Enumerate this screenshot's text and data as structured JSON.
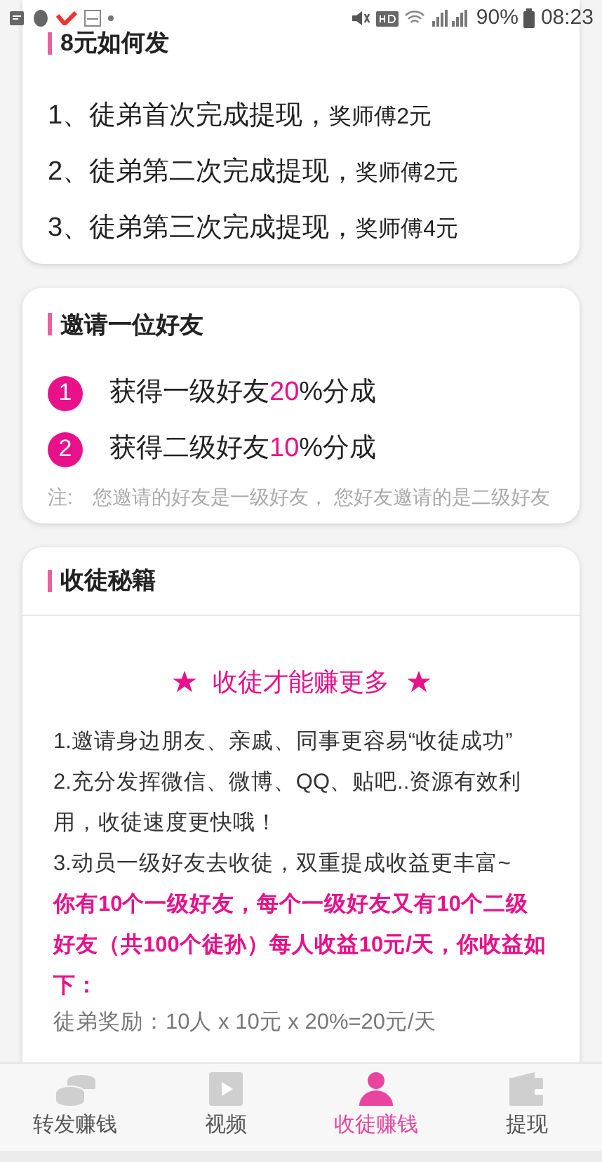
{
  "status_bar": {
    "battery": "90%",
    "time": "08:23"
  },
  "payout_card": {
    "title": "8元如何发",
    "items": [
      {
        "main": "1、徒弟首次完成提现，",
        "reward": "奖师傅2元"
      },
      {
        "main": "2、徒弟第二次完成提现，",
        "reward": "奖师傅2元"
      },
      {
        "main": "3、徒弟第三次完成提现，",
        "reward": "奖师傅4元"
      }
    ]
  },
  "invite_card": {
    "title": "邀请一位好友",
    "items": [
      {
        "number": "1",
        "before": "获得一级好友",
        "highlight": "20",
        "after": "%分成"
      },
      {
        "number": "2",
        "before": "获得二级好友",
        "highlight": "10",
        "after": "%分成"
      }
    ],
    "note_label": "注:",
    "note": "您邀请的好友是一级好友， 您好友邀请的是二级好友"
  },
  "tips_card": {
    "title": "收徒秘籍",
    "slogan": "收徒才能赚更多",
    "lines": [
      "1.邀请身边朋友、亲戚、同事更容易“收徒成功”",
      "2.充分发挥微信、微博、QQ、贴吧..资源有效利用，收徒速度更快哦！",
      "3.动员一级好友去收徒，双重提成收益更丰富~"
    ],
    "highlight": "你有10个一级好友，每个一级好友又有10个二级好友（共100个徒孙）每人收益10元/天，你收益如下：",
    "reward_line": "徒弟奖励：10人 x 10元 x 20%=20元/天"
  },
  "tab_bar": [
    {
      "label": "转发赚钱",
      "kind": "coins",
      "selected": false
    },
    {
      "label": "视频",
      "kind": "video",
      "selected": false
    },
    {
      "label": "收徒赚钱",
      "kind": "person",
      "selected": true
    },
    {
      "label": "提现",
      "kind": "wallet",
      "selected": false
    }
  ]
}
